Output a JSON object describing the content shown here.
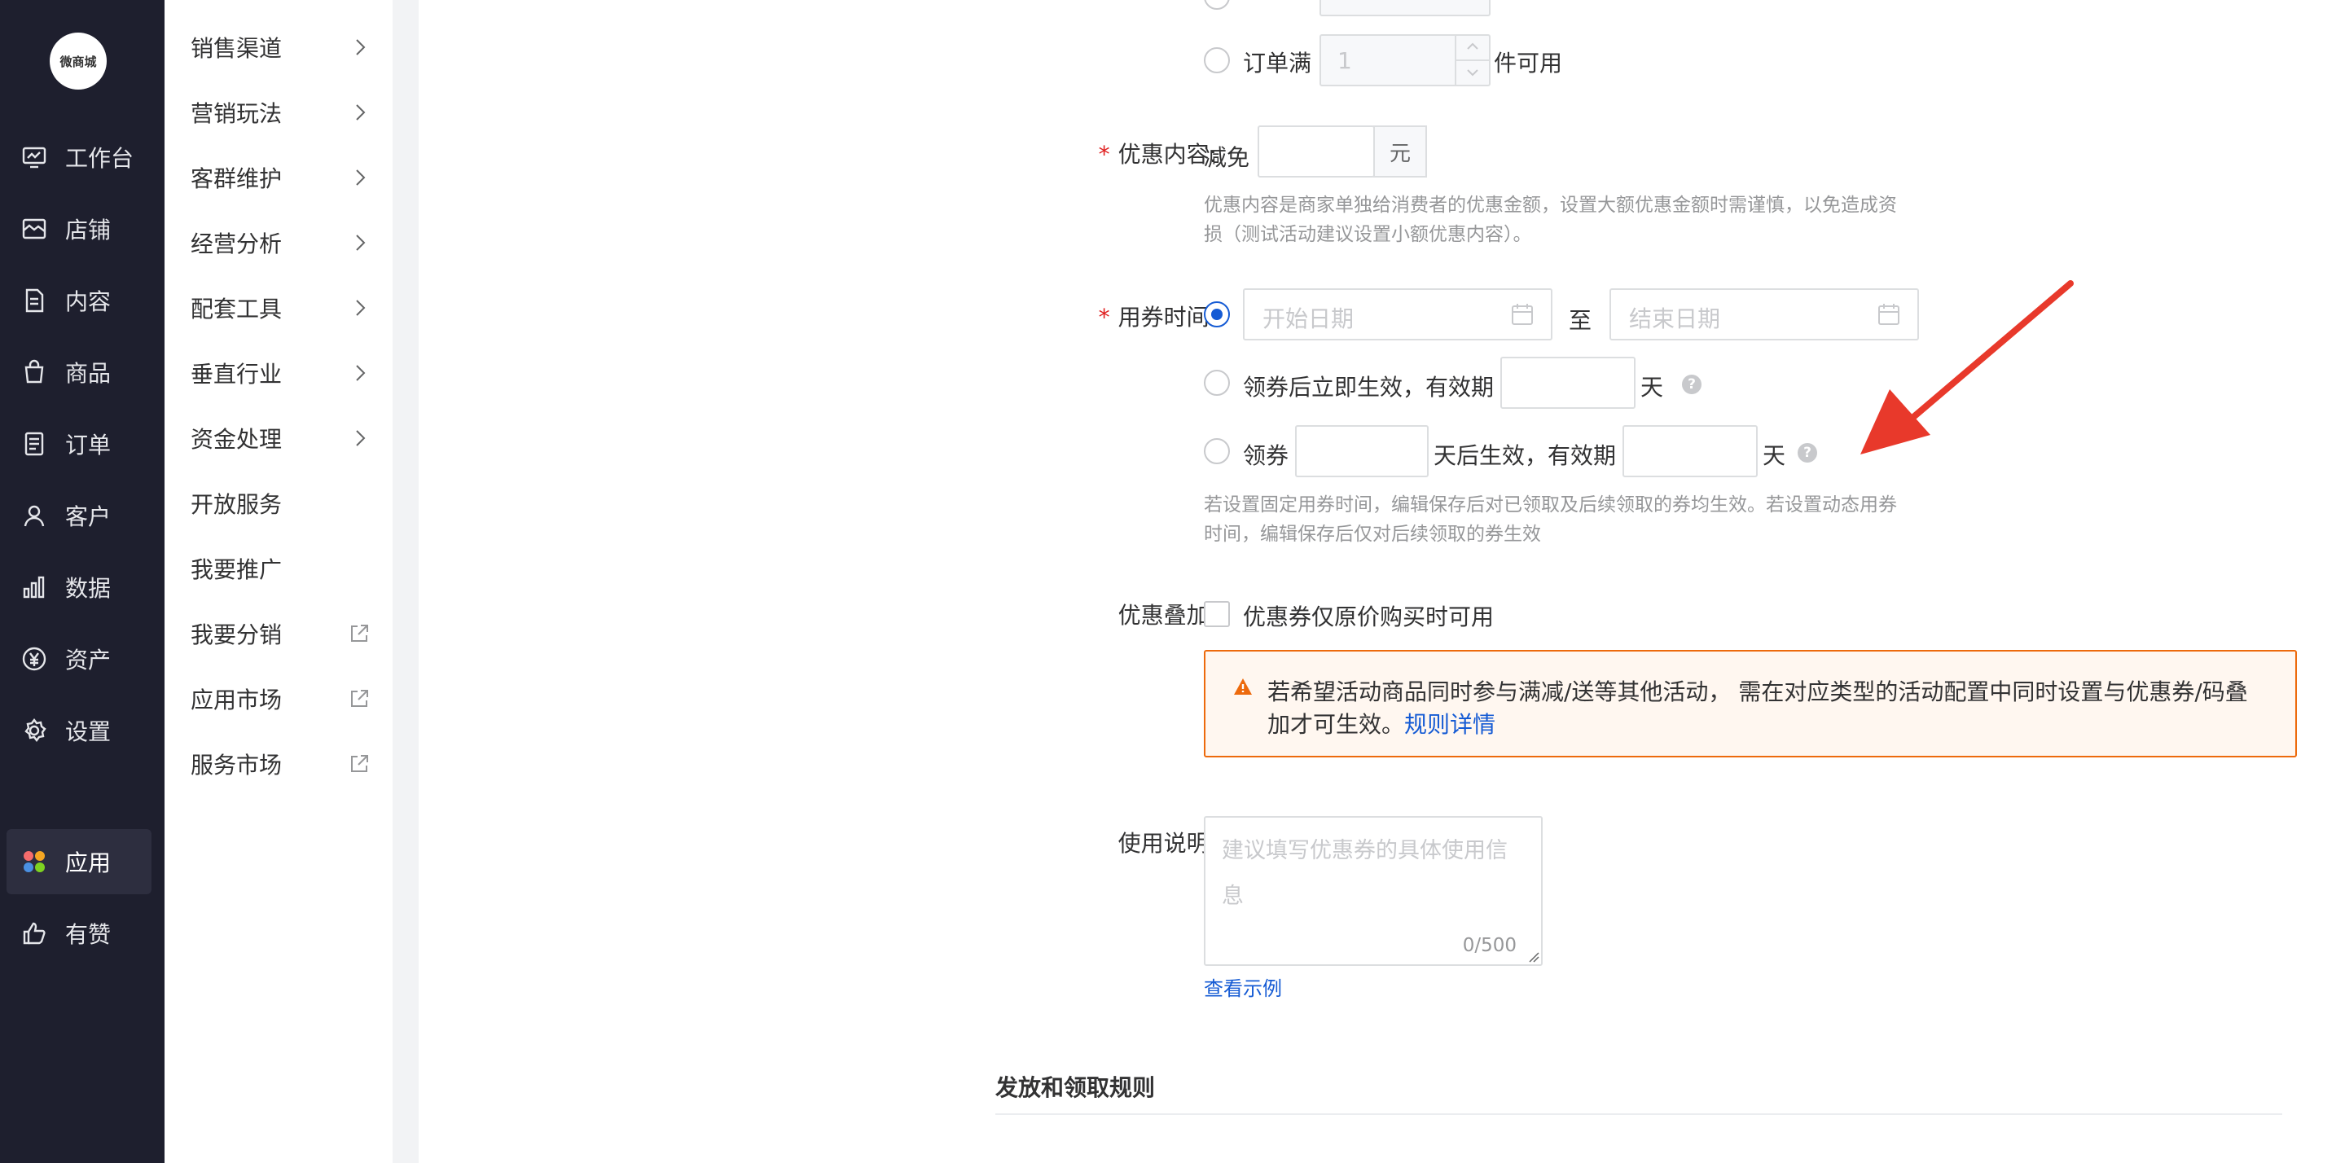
{
  "logo": {
    "text": "微商城"
  },
  "nav_primary": [
    {
      "label": "工作台",
      "icon": "dashboard-icon"
    },
    {
      "label": "店铺",
      "icon": "store-icon"
    },
    {
      "label": "内容",
      "icon": "document-icon"
    },
    {
      "label": "商品",
      "icon": "bag-icon"
    },
    {
      "label": "订单",
      "icon": "order-icon"
    },
    {
      "label": "客户",
      "icon": "user-icon"
    },
    {
      "label": "数据",
      "icon": "bar-chart-icon"
    },
    {
      "label": "资产",
      "icon": "yen-icon"
    },
    {
      "label": "设置",
      "icon": "gear-icon"
    },
    {
      "label": "应用",
      "icon": "apps-icon"
    },
    {
      "label": "有赞",
      "icon": "thumbs-up-icon"
    }
  ],
  "nav_secondary": [
    {
      "label": "销售渠道",
      "suffix": "chevron"
    },
    {
      "label": "营销玩法",
      "suffix": "chevron"
    },
    {
      "label": "客群维护",
      "suffix": "chevron"
    },
    {
      "label": "经营分析",
      "suffix": "chevron"
    },
    {
      "label": "配套工具",
      "suffix": "chevron"
    },
    {
      "label": "垂直行业",
      "suffix": "chevron"
    },
    {
      "label": "资金处理",
      "suffix": "chevron"
    },
    {
      "label": "开放服务",
      "suffix": ""
    },
    {
      "label": "我要推广",
      "suffix": ""
    },
    {
      "label": "我要分销",
      "suffix": "external"
    },
    {
      "label": "应用市场",
      "suffix": "external"
    },
    {
      "label": "服务市场",
      "suffix": "external"
    }
  ],
  "threshold": {
    "order_count_label": "订单满",
    "order_count_value": "1",
    "order_count_suffix": "件可用"
  },
  "discount": {
    "label": "优惠内容:",
    "prefix": "减免",
    "unit": "元",
    "hint_line1": "优惠内容是商家单独给消费者的优惠金额，设置大额优惠金额时需谨慎，以免造成资",
    "hint_line2": "损（测试活动建议设置小额优惠内容）。"
  },
  "use_time": {
    "label": "用券时间:",
    "start_placeholder": "开始日期",
    "to": "至",
    "end_placeholder": "结束日期",
    "opt2_prefix": "领券后立即生效，有效期",
    "day": "天",
    "opt3_prefix": "领券",
    "opt3_mid": "天后生效，有效期",
    "hint_line1": "若设置固定用券时间，编辑保存后对已领取及后续领取的券均生效。若设置动态用券",
    "hint_line2": "时间，编辑保存后仅对后续领取的券生效"
  },
  "stacking": {
    "label": "优惠叠加:",
    "checkbox_label": "优惠券仅原价购买时可用",
    "alert_line1": "若希望活动商品同时参与满减/送等其他活动， 需在对应类型的活动配置中同时设置与优惠券/码叠",
    "alert_line2": "加才可生效。",
    "alert_link": "规则详情"
  },
  "usage": {
    "label": "使用说明:",
    "placeholder_line1": "建议填写优惠券的具体使用信",
    "placeholder_line2": "息",
    "counter": "0/500",
    "example_link": "查看示例"
  },
  "section": {
    "title": "发放和领取规则"
  },
  "colors": {
    "accent": "#155bd4",
    "danger": "#e02020",
    "warning": "#ed6a0c",
    "annotation_arrow": "#e8392b"
  }
}
